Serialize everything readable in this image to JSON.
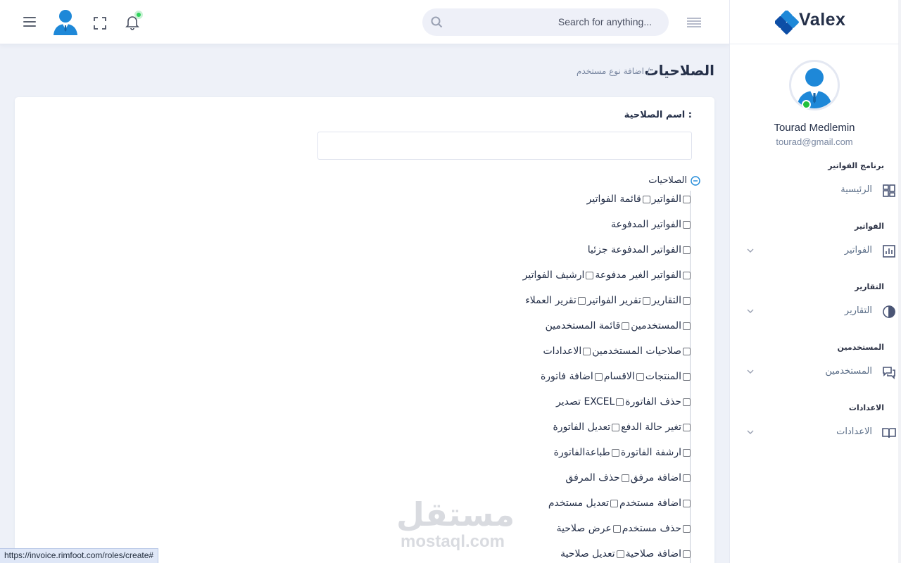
{
  "header": {
    "search_placeholder": "Search for anything...",
    "notification_dot_color": "#2ed35b"
  },
  "sidebar": {
    "logo_text": "Valex",
    "user": {
      "name": "Tourad Medlemin",
      "email": "tourad@gmail.com",
      "online": true
    },
    "sections": [
      {
        "category": "برنامج الفواتير",
        "item": "الرئيسية",
        "icon": "dashboard-icon",
        "has_submenu": false
      },
      {
        "category": "الفواتير",
        "item": "الفواتير",
        "icon": "bar-chart-icon",
        "has_submenu": true
      },
      {
        "category": "التقارير",
        "item": "التقارير",
        "icon": "pie-chart-icon",
        "has_submenu": true
      },
      {
        "category": "المستخدمين",
        "item": "المستخدمين",
        "icon": "chat-icon",
        "has_submenu": true
      },
      {
        "category": "الاعدادات",
        "item": "الاعدادات",
        "icon": "book-icon",
        "has_submenu": true
      }
    ]
  },
  "page": {
    "title": "الصلاحيات",
    "breadcrumb_current": "اضافة نوع مستخدم",
    "breadcrumb_sep": "/"
  },
  "form": {
    "name_label": "اسم الصلاحية :",
    "name_value": "",
    "tree_root": "الصلاحيات",
    "permission_rows": [
      [
        "الفواتير",
        "قائمة الفواتير"
      ],
      [
        "الفواتير المدفوعة"
      ],
      [
        "الفواتير المدفوعة جزئيا"
      ],
      [
        "الفواتير الغير مدفوعة",
        "ارشيف الفواتير"
      ],
      [
        "التقارير",
        "تقرير الفواتير",
        "تقرير العملاء"
      ],
      [
        "المستخدمين",
        "قائمة المستخدمين"
      ],
      [
        "صلاحيات المستخدمين",
        "الاعدادات"
      ],
      [
        "المنتجات",
        "الاقسام",
        "اضافة فاتورة"
      ],
      [
        "حذف الفاتورة",
        "تصدير EXCEL"
      ],
      [
        "تغير حالة الدفع",
        "تعديل الفاتورة"
      ],
      [
        "ارشفة الفاتورة",
        "طباعةالفاتورة"
      ],
      [
        "اضافة مرفق",
        "حذف المرفق"
      ],
      [
        "اضافة مستخدم",
        "تعديل مستخدم"
      ],
      [
        "حذف مستخدم",
        "عرض صلاحية"
      ],
      [
        "اضافة صلاحية",
        "تعديل صلاحية"
      ]
    ]
  },
  "watermark": {
    "arabic": "مستقل",
    "latin": "mostaql.com"
  },
  "status_bar": {
    "url": "https://invoice.rimfoot.com/roles/create#"
  }
}
